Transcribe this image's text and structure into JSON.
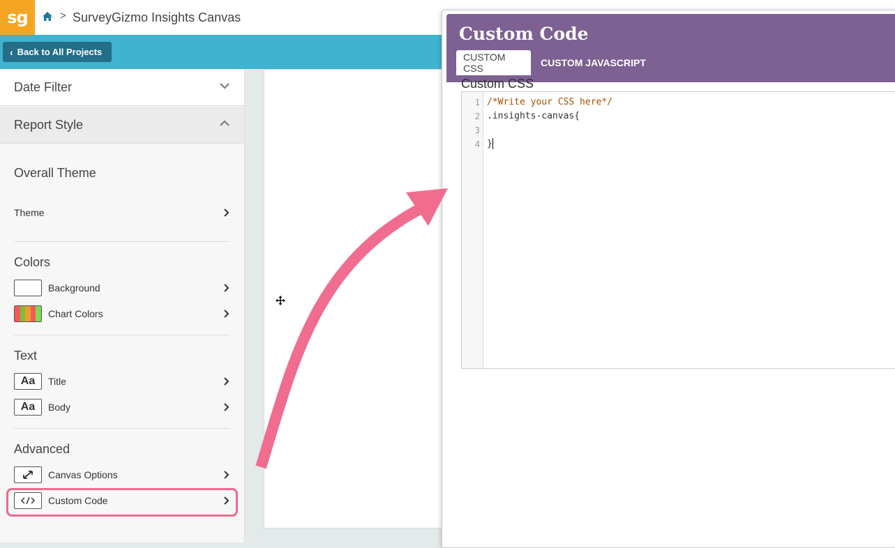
{
  "header": {
    "logo_text": "sg",
    "breadcrumb_separator": ">",
    "title": "SurveyGizmo Insights Canvas"
  },
  "toolbar": {
    "back_label": "Back to All Projects"
  },
  "sidebar": {
    "date_filter_label": "Date Filter",
    "report_style_label": "Report Style",
    "overall_theme": {
      "heading": "Overall Theme",
      "theme_label": "Theme"
    },
    "colors": {
      "heading": "Colors",
      "background_label": "Background",
      "chart_colors_label": "Chart Colors",
      "chart_swatch_colors": [
        "#f25c54",
        "#7dbf3b",
        "#f29a2e",
        "#43c3e0",
        "#7ed957"
      ]
    },
    "text": {
      "heading": "Text",
      "title_label": "Title",
      "body_label": "Body",
      "font_sample": "Aa"
    },
    "advanced": {
      "heading": "Advanced",
      "canvas_options_label": "Canvas Options",
      "custom_code_label": "Custom Code"
    }
  },
  "panel": {
    "title": "Custom Code",
    "tabs": [
      {
        "label": "CUSTOM CSS",
        "active": true
      },
      {
        "label": "CUSTOM JAVASCRIPT",
        "active": false
      }
    ],
    "editor_label": "Custom CSS",
    "code_lines": [
      {
        "num": "1",
        "text": "/*Write your CSS here*/"
      },
      {
        "num": "2",
        "text": ".insights-canvas{"
      },
      {
        "num": "3",
        "text": ""
      },
      {
        "num": "4",
        "text": "}"
      }
    ]
  },
  "colors": {
    "brand_orange": "#f5a524",
    "top_blue": "#3fb3d0",
    "panel_purple": "#7d6192",
    "highlight_pink": "#ec6b8d"
  }
}
